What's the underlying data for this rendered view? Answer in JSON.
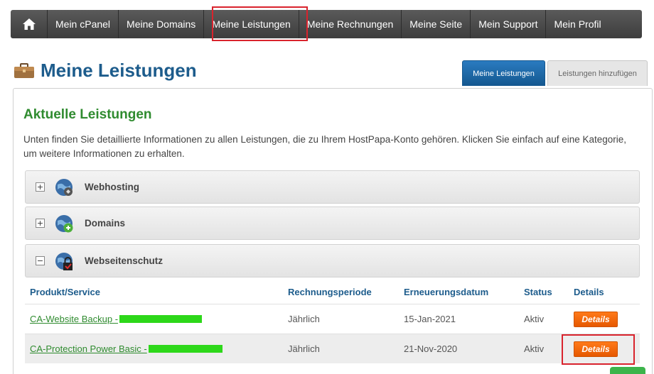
{
  "nav": {
    "home_icon": "home-icon",
    "items": [
      "Mein cPanel",
      "Meine Domains",
      "Meine Leistungen",
      "Meine Rechnungen",
      "Meine Seite",
      "Mein Support",
      "Mein Profil"
    ]
  },
  "page": {
    "title": "Meine Leistungen",
    "icon": "briefcase-icon"
  },
  "tabs": [
    {
      "label": "Meine Leistungen",
      "active": true
    },
    {
      "label": "Leistungen hinzufügen",
      "active": false
    }
  ],
  "section": {
    "title": "Aktuelle Leistungen",
    "intro": "Unten finden Sie detaillierte Informationen zu allen Leistungen, die zu Ihrem HostPapa-Konto gehören. Klicken Sie einfach auf eine Kategorie, um weitere Informationen zu erhalten."
  },
  "categories": [
    {
      "label": "Webhosting",
      "toggle": "+",
      "icon": "webhosting-globe-icon"
    },
    {
      "label": "Domains",
      "toggle": "+",
      "icon": "domains-globe-icon"
    },
    {
      "label": "Webseitenschutz",
      "toggle": "−",
      "icon": "protection-globe-icon"
    }
  ],
  "table": {
    "headers": [
      "Produkt/Service",
      "Rechnungsperiode",
      "Erneuerungsdatum",
      "Status",
      "Details"
    ],
    "rows": [
      {
        "product": "CA-Website Backup -",
        "period": "Jährlich",
        "renewal": "15-Jan-2021",
        "status": "Aktiv",
        "action": "Details"
      },
      {
        "product": "CA-Protection Power Basic -",
        "period": "Jährlich",
        "renewal": "21-Nov-2020",
        "status": "Aktiv",
        "action": "Details"
      }
    ]
  },
  "colors": {
    "nav_bg": "#4a4a4a",
    "title_blue": "#1d5c8c",
    "section_green": "#2f8b2f",
    "button_orange": "#f26a0f",
    "highlight_red": "#d9232d",
    "redaction_green": "#2dd81a"
  }
}
